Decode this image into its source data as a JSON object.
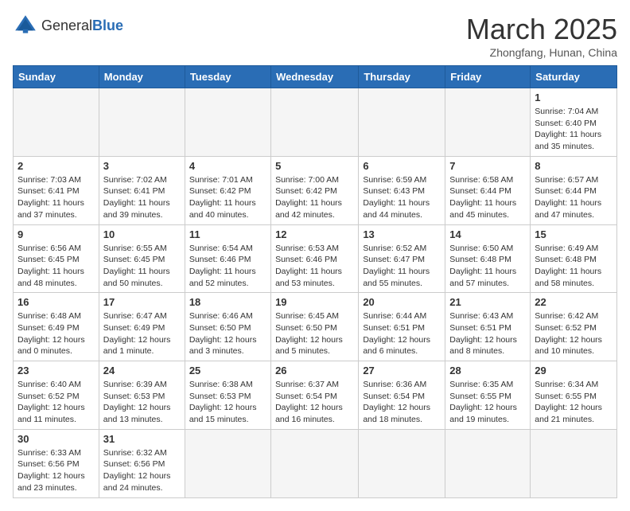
{
  "header": {
    "logo_text_normal": "General",
    "logo_text_bold": "Blue",
    "month": "March 2025",
    "location": "Zhongfang, Hunan, China"
  },
  "weekdays": [
    "Sunday",
    "Monday",
    "Tuesday",
    "Wednesday",
    "Thursday",
    "Friday",
    "Saturday"
  ],
  "weeks": [
    [
      {
        "day": "",
        "info": ""
      },
      {
        "day": "",
        "info": ""
      },
      {
        "day": "",
        "info": ""
      },
      {
        "day": "",
        "info": ""
      },
      {
        "day": "",
        "info": ""
      },
      {
        "day": "",
        "info": ""
      },
      {
        "day": "1",
        "info": "Sunrise: 7:04 AM\nSunset: 6:40 PM\nDaylight: 11 hours and 35 minutes."
      }
    ],
    [
      {
        "day": "2",
        "info": "Sunrise: 7:03 AM\nSunset: 6:41 PM\nDaylight: 11 hours and 37 minutes."
      },
      {
        "day": "3",
        "info": "Sunrise: 7:02 AM\nSunset: 6:41 PM\nDaylight: 11 hours and 39 minutes."
      },
      {
        "day": "4",
        "info": "Sunrise: 7:01 AM\nSunset: 6:42 PM\nDaylight: 11 hours and 40 minutes."
      },
      {
        "day": "5",
        "info": "Sunrise: 7:00 AM\nSunset: 6:42 PM\nDaylight: 11 hours and 42 minutes."
      },
      {
        "day": "6",
        "info": "Sunrise: 6:59 AM\nSunset: 6:43 PM\nDaylight: 11 hours and 44 minutes."
      },
      {
        "day": "7",
        "info": "Sunrise: 6:58 AM\nSunset: 6:44 PM\nDaylight: 11 hours and 45 minutes."
      },
      {
        "day": "8",
        "info": "Sunrise: 6:57 AM\nSunset: 6:44 PM\nDaylight: 11 hours and 47 minutes."
      }
    ],
    [
      {
        "day": "9",
        "info": "Sunrise: 6:56 AM\nSunset: 6:45 PM\nDaylight: 11 hours and 48 minutes."
      },
      {
        "day": "10",
        "info": "Sunrise: 6:55 AM\nSunset: 6:45 PM\nDaylight: 11 hours and 50 minutes."
      },
      {
        "day": "11",
        "info": "Sunrise: 6:54 AM\nSunset: 6:46 PM\nDaylight: 11 hours and 52 minutes."
      },
      {
        "day": "12",
        "info": "Sunrise: 6:53 AM\nSunset: 6:46 PM\nDaylight: 11 hours and 53 minutes."
      },
      {
        "day": "13",
        "info": "Sunrise: 6:52 AM\nSunset: 6:47 PM\nDaylight: 11 hours and 55 minutes."
      },
      {
        "day": "14",
        "info": "Sunrise: 6:50 AM\nSunset: 6:48 PM\nDaylight: 11 hours and 57 minutes."
      },
      {
        "day": "15",
        "info": "Sunrise: 6:49 AM\nSunset: 6:48 PM\nDaylight: 11 hours and 58 minutes."
      }
    ],
    [
      {
        "day": "16",
        "info": "Sunrise: 6:48 AM\nSunset: 6:49 PM\nDaylight: 12 hours and 0 minutes."
      },
      {
        "day": "17",
        "info": "Sunrise: 6:47 AM\nSunset: 6:49 PM\nDaylight: 12 hours and 1 minute."
      },
      {
        "day": "18",
        "info": "Sunrise: 6:46 AM\nSunset: 6:50 PM\nDaylight: 12 hours and 3 minutes."
      },
      {
        "day": "19",
        "info": "Sunrise: 6:45 AM\nSunset: 6:50 PM\nDaylight: 12 hours and 5 minutes."
      },
      {
        "day": "20",
        "info": "Sunrise: 6:44 AM\nSunset: 6:51 PM\nDaylight: 12 hours and 6 minutes."
      },
      {
        "day": "21",
        "info": "Sunrise: 6:43 AM\nSunset: 6:51 PM\nDaylight: 12 hours and 8 minutes."
      },
      {
        "day": "22",
        "info": "Sunrise: 6:42 AM\nSunset: 6:52 PM\nDaylight: 12 hours and 10 minutes."
      }
    ],
    [
      {
        "day": "23",
        "info": "Sunrise: 6:40 AM\nSunset: 6:52 PM\nDaylight: 12 hours and 11 minutes."
      },
      {
        "day": "24",
        "info": "Sunrise: 6:39 AM\nSunset: 6:53 PM\nDaylight: 12 hours and 13 minutes."
      },
      {
        "day": "25",
        "info": "Sunrise: 6:38 AM\nSunset: 6:53 PM\nDaylight: 12 hours and 15 minutes."
      },
      {
        "day": "26",
        "info": "Sunrise: 6:37 AM\nSunset: 6:54 PM\nDaylight: 12 hours and 16 minutes."
      },
      {
        "day": "27",
        "info": "Sunrise: 6:36 AM\nSunset: 6:54 PM\nDaylight: 12 hours and 18 minutes."
      },
      {
        "day": "28",
        "info": "Sunrise: 6:35 AM\nSunset: 6:55 PM\nDaylight: 12 hours and 19 minutes."
      },
      {
        "day": "29",
        "info": "Sunrise: 6:34 AM\nSunset: 6:55 PM\nDaylight: 12 hours and 21 minutes."
      }
    ],
    [
      {
        "day": "30",
        "info": "Sunrise: 6:33 AM\nSunset: 6:56 PM\nDaylight: 12 hours and 23 minutes."
      },
      {
        "day": "31",
        "info": "Sunrise: 6:32 AM\nSunset: 6:56 PM\nDaylight: 12 hours and 24 minutes."
      },
      {
        "day": "",
        "info": ""
      },
      {
        "day": "",
        "info": ""
      },
      {
        "day": "",
        "info": ""
      },
      {
        "day": "",
        "info": ""
      },
      {
        "day": "",
        "info": ""
      }
    ]
  ]
}
